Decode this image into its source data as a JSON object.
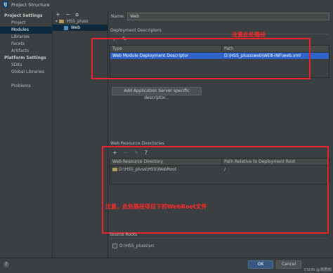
{
  "window": {
    "title": "Project Structure",
    "logo": "IJ"
  },
  "left_nav": {
    "project_settings_header": "Project Settings",
    "project_settings": [
      "Project",
      "Modules",
      "Libraries",
      "Facets",
      "Artifacts"
    ],
    "platform_settings_header": "Platform Settings",
    "platform_settings": [
      "SDKs",
      "Global Libraries"
    ],
    "problems": "Problems"
  },
  "tree": {
    "toolbar": [
      "+",
      "−",
      "⧉"
    ],
    "module": "HSS_pluss",
    "facet": "Web"
  },
  "main": {
    "name_label": "Name:",
    "name_value": "Web",
    "deployment_descriptors": {
      "title": "Deployment Descriptors",
      "toolbar": [
        "+",
        "✎"
      ],
      "headers": [
        "Type",
        "Path"
      ],
      "row": {
        "type": "Web Module Deployment Descriptor",
        "path": "D:\\HSS_pluss\\web\\WEB-INF\\web.xml"
      },
      "add_server_button": "Add Application Server specific descriptor..."
    },
    "web_resource_directories": {
      "title": "Web Resource Directories",
      "toolbar": [
        "+",
        "−",
        "✎",
        "?"
      ],
      "headers": [
        "Web Resource Directory",
        "Path Relative to Deployment Root"
      ],
      "row": {
        "directory": "D:\\HSS_pluss\\HSS\\WebRoot",
        "relative": "/"
      }
    },
    "source_roots": {
      "title": "Source Roots",
      "row": "D:\\HSS_pluss\\src"
    }
  },
  "annotations": {
    "path_note": "注意此处路径",
    "webroot_note": "注意，此处路径项目下的WebRoot文件"
  },
  "bottom": {
    "help": "?",
    "ok": "OK",
    "cancel": "Cancel",
    "watermark": "CSDN @洞悉知"
  },
  "colors": {
    "accent_selection": "#2f65ca",
    "nav_selection": "#0d293e",
    "annotation_red": "#e8232c"
  }
}
